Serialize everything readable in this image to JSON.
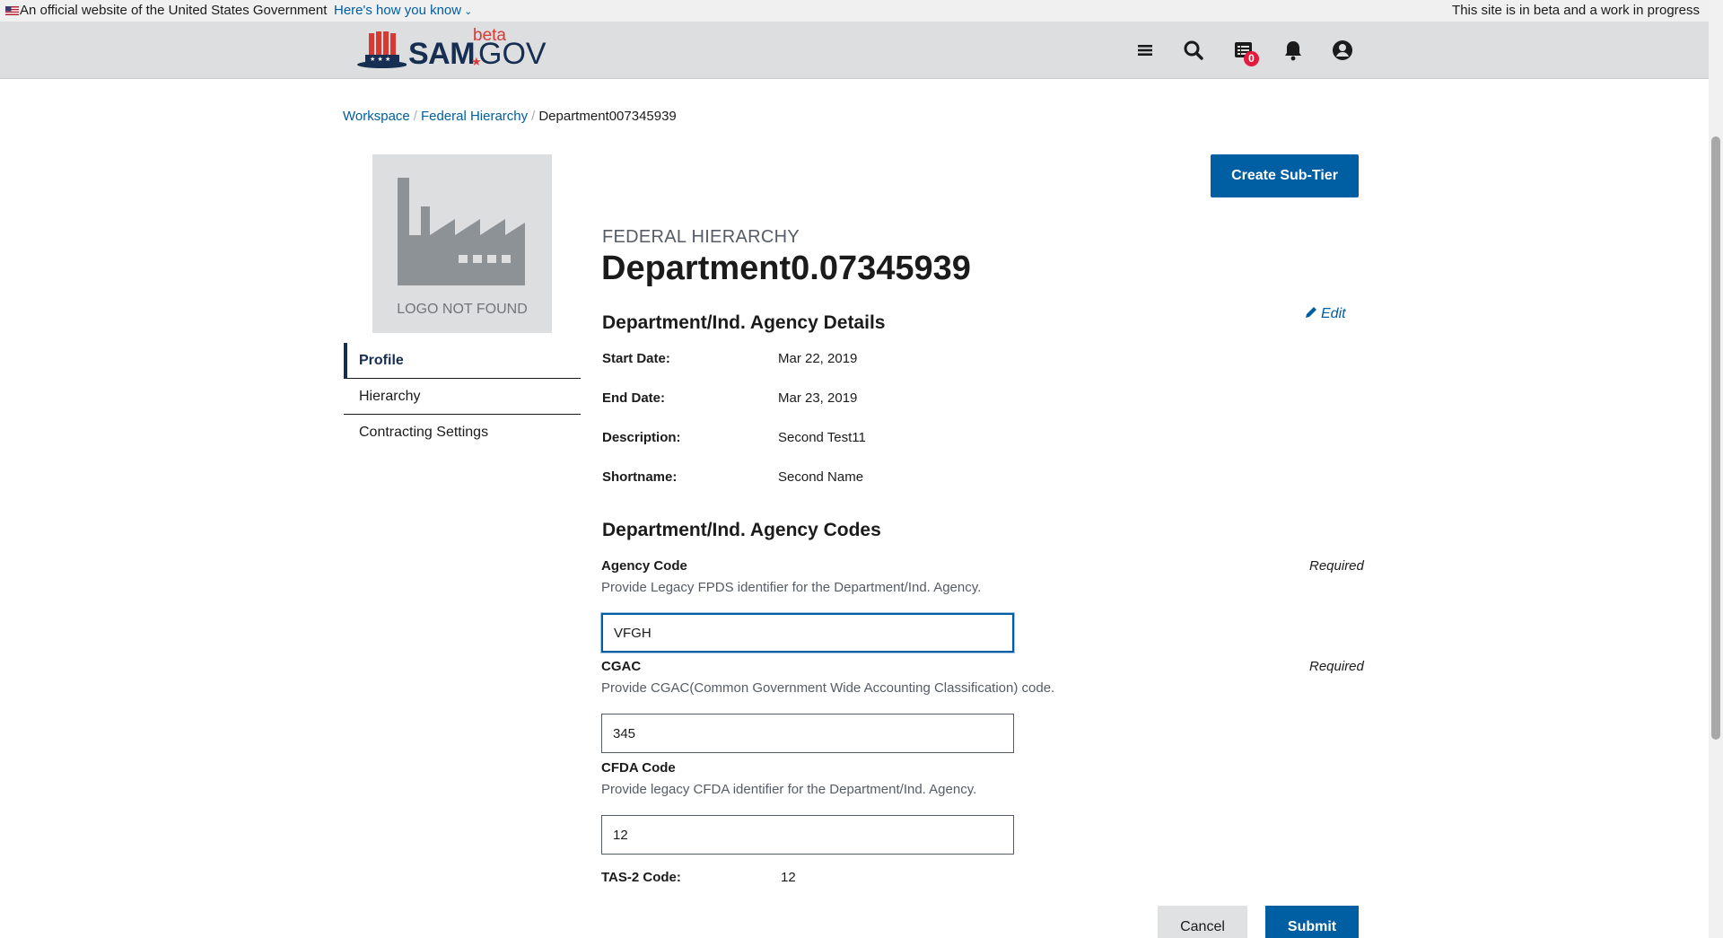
{
  "gov_banner": {
    "official_text": "An official website of the United States Government",
    "how_you_know": "Here's how you know",
    "beta_note": "This site is in beta and a work in progress"
  },
  "header": {
    "logo": {
      "sam": "SAM",
      "gov": "GOV",
      "beta": "beta"
    },
    "icons": [
      "menu-icon",
      "search-icon",
      "messages-icon",
      "notifications-icon",
      "account-icon"
    ],
    "messages_count": "0"
  },
  "breadcrumb": {
    "items": [
      "Workspace",
      "Federal Hierarchy"
    ],
    "current": "Department007345939"
  },
  "logo_placeholder": "LOGO NOT FOUND",
  "side_nav": {
    "items": [
      {
        "label": "Profile",
        "active": true
      },
      {
        "label": "Hierarchy",
        "active": false
      },
      {
        "label": "Contracting Settings",
        "active": false
      }
    ]
  },
  "actions": {
    "create_sub_tier": "Create Sub-Tier",
    "edit": "Edit",
    "cancel": "Cancel",
    "submit": "Submit"
  },
  "page": {
    "eyebrow": "FEDERAL HIERARCHY",
    "title": "Department0.07345939"
  },
  "details": {
    "title": "Department/Ind. Agency Details",
    "rows": [
      {
        "label": "Start Date:",
        "value": "Mar 22, 2019"
      },
      {
        "label": "End Date:",
        "value": "Mar 23, 2019"
      },
      {
        "label": "Description:",
        "value": "Second Test11"
      },
      {
        "label": "Shortname:",
        "value": "Second Name"
      }
    ]
  },
  "codes": {
    "title": "Department/Ind. Agency Codes",
    "required_text": "Required",
    "agency_code": {
      "label": "Agency Code",
      "hint": "Provide Legacy FPDS identifier for the Department/Ind. Agency.",
      "value": "VFGH"
    },
    "cgac": {
      "label": "CGAC",
      "hint": "Provide CGAC(Common Government Wide Accounting Classification) code.",
      "value": "345"
    },
    "cfda": {
      "label": "CFDA Code",
      "hint": "Provide legacy CFDA identifier for the Department/Ind. Agency.",
      "value": "12"
    },
    "tas2": {
      "label": "TAS-2 Code:",
      "value": "12"
    }
  },
  "colors": {
    "primary": "#005ea2",
    "header_bg": "#dcdee0",
    "badge": "#e31c3d",
    "brand_red": "#d83933",
    "brand_navy": "#162e51"
  }
}
